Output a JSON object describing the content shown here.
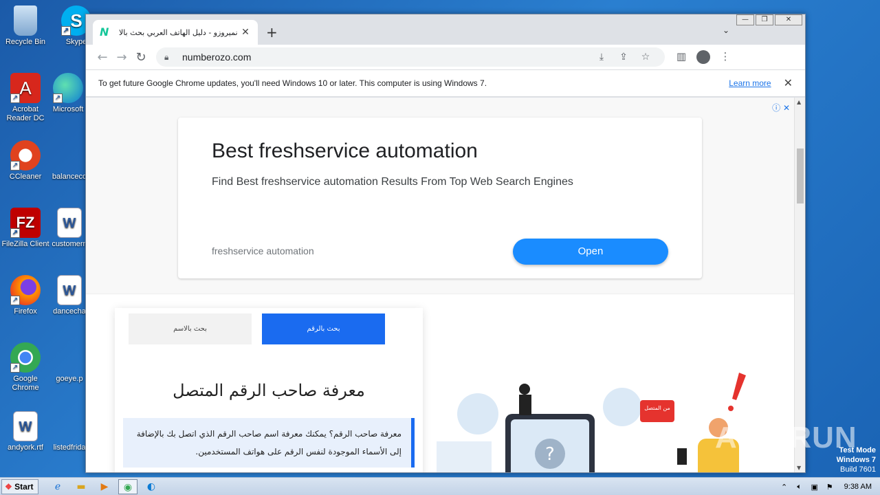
{
  "desktop": {
    "icons": [
      {
        "label": "Recycle Bin"
      },
      {
        "label": "Skype"
      },
      {
        "label": "Acrobat Reader DC"
      },
      {
        "label": "Microsoft"
      },
      {
        "label": "CCleaner"
      },
      {
        "label": "balanceco"
      },
      {
        "label": "FileZilla Client"
      },
      {
        "label": "customern"
      },
      {
        "label": "Firefox"
      },
      {
        "label": "dancecha"
      },
      {
        "label": "Google Chrome"
      },
      {
        "label": "goeye.p"
      },
      {
        "label": "andyork.rtf"
      },
      {
        "label": "listedfrida"
      }
    ]
  },
  "browser": {
    "tab_title": "نميروزو - دليل الهاتف العربي بحث بالا",
    "favicon": "N",
    "url": "numberozo.com",
    "infobar_message": "To get future Google Chrome updates, you'll need Windows 10 or later. This computer is using Windows 7.",
    "infobar_link": "Learn more"
  },
  "ad": {
    "title": "Best freshservice automation",
    "description": "Find Best freshservice automation Results From Top Web Search Engines",
    "domain": "freshservice automation",
    "button": "Open"
  },
  "search": {
    "by_name": "بحث بالاسم",
    "by_number": "بحث بالرقم",
    "heading": "معرفة صاحب الرقم المتصل",
    "info": "معرفة صاحب الرقم؟ يمكنك معرفة اسم صاحب الرقم الذي اتصل بك بالإضافة إلى الأسماء الموجودة لنفس الرقم على هواتف المستخدمين."
  },
  "illustration": {
    "badge": "من المتصل"
  },
  "taskbar": {
    "start": "Start",
    "clock": "9:38 AM"
  },
  "overlay": {
    "watermark": "ANY RUN",
    "test_mode_line1": "Test Mode",
    "test_mode_line2": "Windows 7",
    "test_mode_line3": "Build 7601"
  },
  "colors": {
    "accent": "#1a6bf0",
    "ad_button": "#1a8cff",
    "favicon": "#16c79a"
  }
}
